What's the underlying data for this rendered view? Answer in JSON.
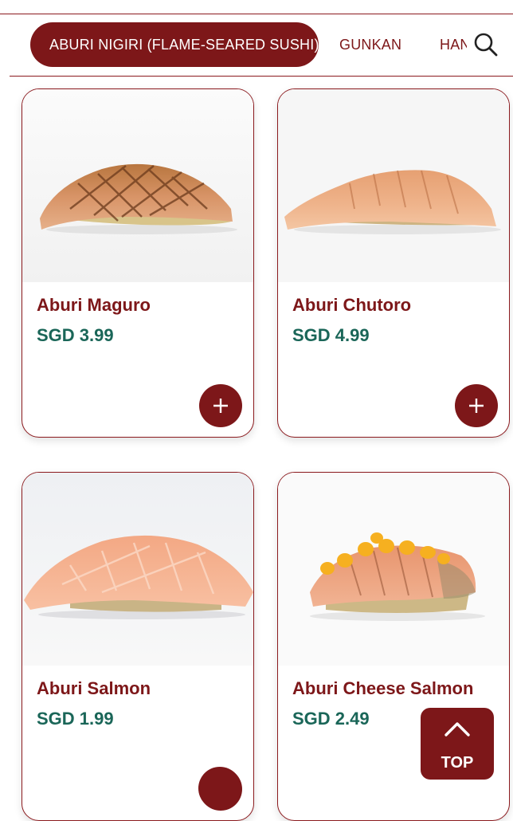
{
  "categories": {
    "active": "ABURI NIGIRI (FLAME-SEARED SUSHI)",
    "tab2": "GUNKAN",
    "tab3": "HANDROLL"
  },
  "search": {
    "icon": "search-icon"
  },
  "products": [
    {
      "name": "Aburi Maguro",
      "price": "SGD 3.99"
    },
    {
      "name": "Aburi Chutoro",
      "price": "SGD 4.99"
    },
    {
      "name": "Aburi Salmon",
      "price": "SGD 1.99"
    },
    {
      "name": "Aburi Cheese Salmon",
      "price": "SGD 2.49"
    }
  ],
  "add_icon": "plus-icon",
  "back_to_top": {
    "label": "TOP",
    "icon": "chevron-up-icon"
  },
  "colors": {
    "brand_red": "#7d1719",
    "price_green": "#1a6658",
    "border": "#8b1a1e"
  }
}
